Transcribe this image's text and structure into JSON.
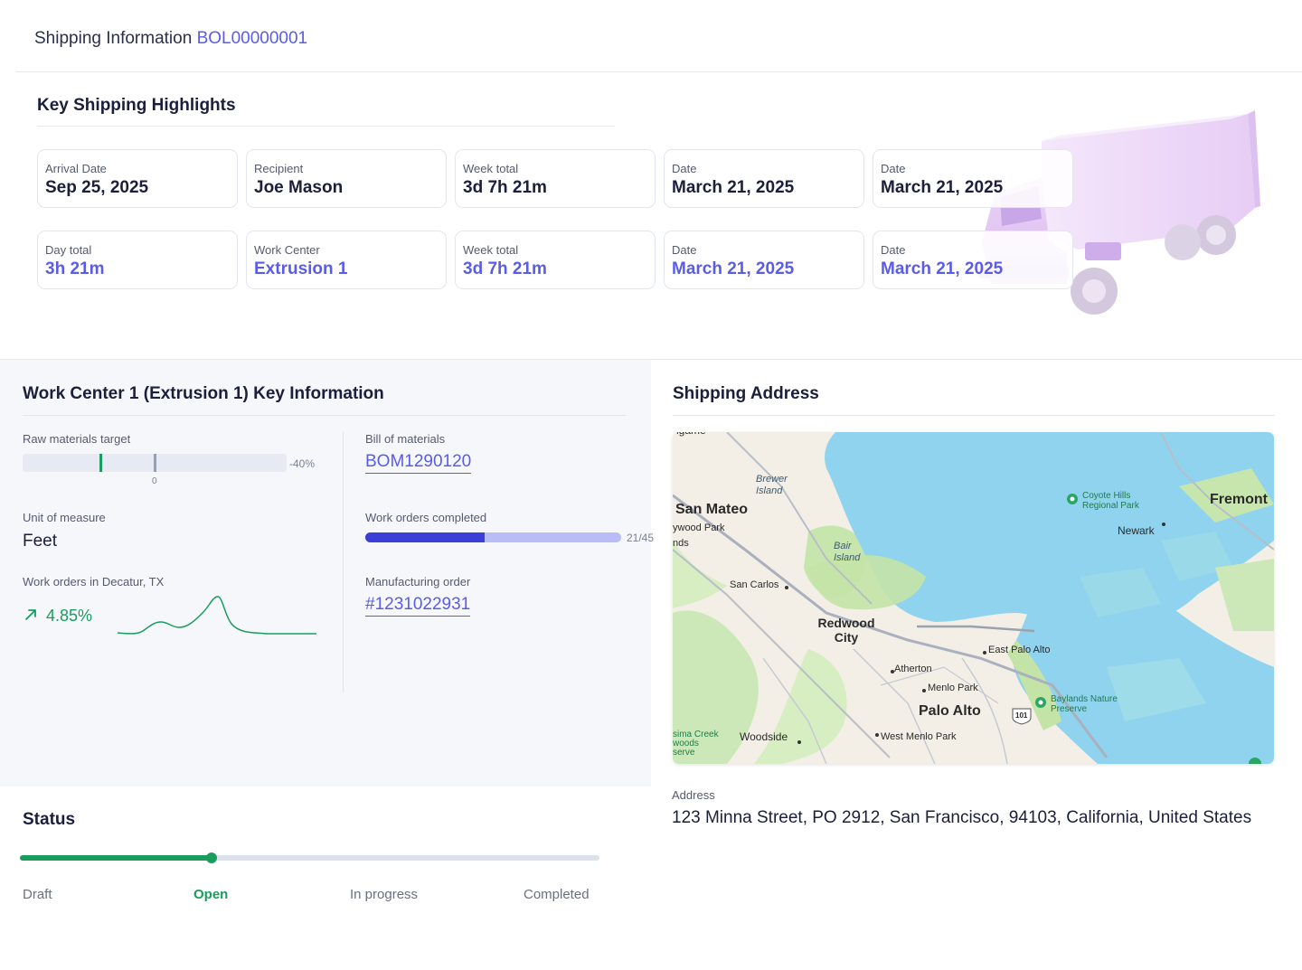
{
  "header": {
    "title": "Shipping Information",
    "bol_number": "BOL00000001"
  },
  "highlights": {
    "title": "Key Shipping Highlights",
    "cards": [
      {
        "label": "Arrival Date",
        "value": "Sep 25, 2025"
      },
      {
        "label": "Recipient",
        "value": "Joe Mason"
      },
      {
        "label": "Week total",
        "value": "3d 7h 21m"
      },
      {
        "label": "Date",
        "value": "March 21, 2025"
      },
      {
        "label": "Date",
        "value": "March 21, 2025"
      },
      {
        "label": "Day total",
        "value": "3h 21m"
      },
      {
        "label": "Work Center",
        "value": "Extrusion 1"
      },
      {
        "label": "Week total",
        "value": "3d 7h 21m"
      },
      {
        "label": "Date",
        "value": "March 21, 2025"
      },
      {
        "label": "Date",
        "value": "March 21, 2025"
      }
    ]
  },
  "work_center": {
    "title": "Work Center 1 (Extrusion 1) Key Information",
    "raw_materials": {
      "label": "Raw materials target",
      "percent": "-40%",
      "zero_tick": "0"
    },
    "unit_of_measure": {
      "label": "Unit of measure",
      "value": "Feet"
    },
    "work_orders_location": {
      "label": "Work orders in Decatur, TX",
      "trend": "4.85%",
      "trend_direction": "up"
    },
    "bill_of_materials": {
      "label": "Bill of materials",
      "value": "BOM1290120"
    },
    "work_orders_completed": {
      "label": "Work orders completed",
      "count": "21/45",
      "completed": 21,
      "total": 45
    },
    "manufacturing_order": {
      "label": "Manufacturing order",
      "value": "#1231022931"
    }
  },
  "shipping_address": {
    "title": "Shipping Address",
    "address_label": "Address",
    "address": "123 Minna Street, PO 2912, San Francisco, 94103, California, United States",
    "map_labels": {
      "san_mateo": "San Mateo",
      "fremont": "Fremont",
      "redwood_city": "Redwood City",
      "palo_alto": "Palo Alto",
      "brewer_island": "Brewer Island",
      "bair_island": "Bair Island",
      "coyote_hills": "Coyote Hills Regional Park",
      "newark": "Newark",
      "san_carlos": "San Carlos",
      "east_palo_alto": "East Palo Alto",
      "atherton": "Atherton",
      "menlo_park": "Menlo Park",
      "baylands": "Baylands Nature Preserve",
      "woodside": "Woodside",
      "west_menlo_park": "West Menlo Park",
      "highway": "101",
      "edge_hayward_park": "ywood Park",
      "edge_lands": "nds",
      "edge_top": "ngame",
      "edge_purisima": "sima Creek\nwoods\nserve"
    }
  },
  "status": {
    "title": "Status",
    "steps": [
      "Draft",
      "Open",
      "In progress",
      "Completed"
    ],
    "current_step": "Open"
  },
  "colors": {
    "accent_purple": "#5a5ce6",
    "success_green": "#1a9d5c",
    "progress_blue": "#3b3fd6",
    "panel_bg": "#f6f7fb"
  }
}
